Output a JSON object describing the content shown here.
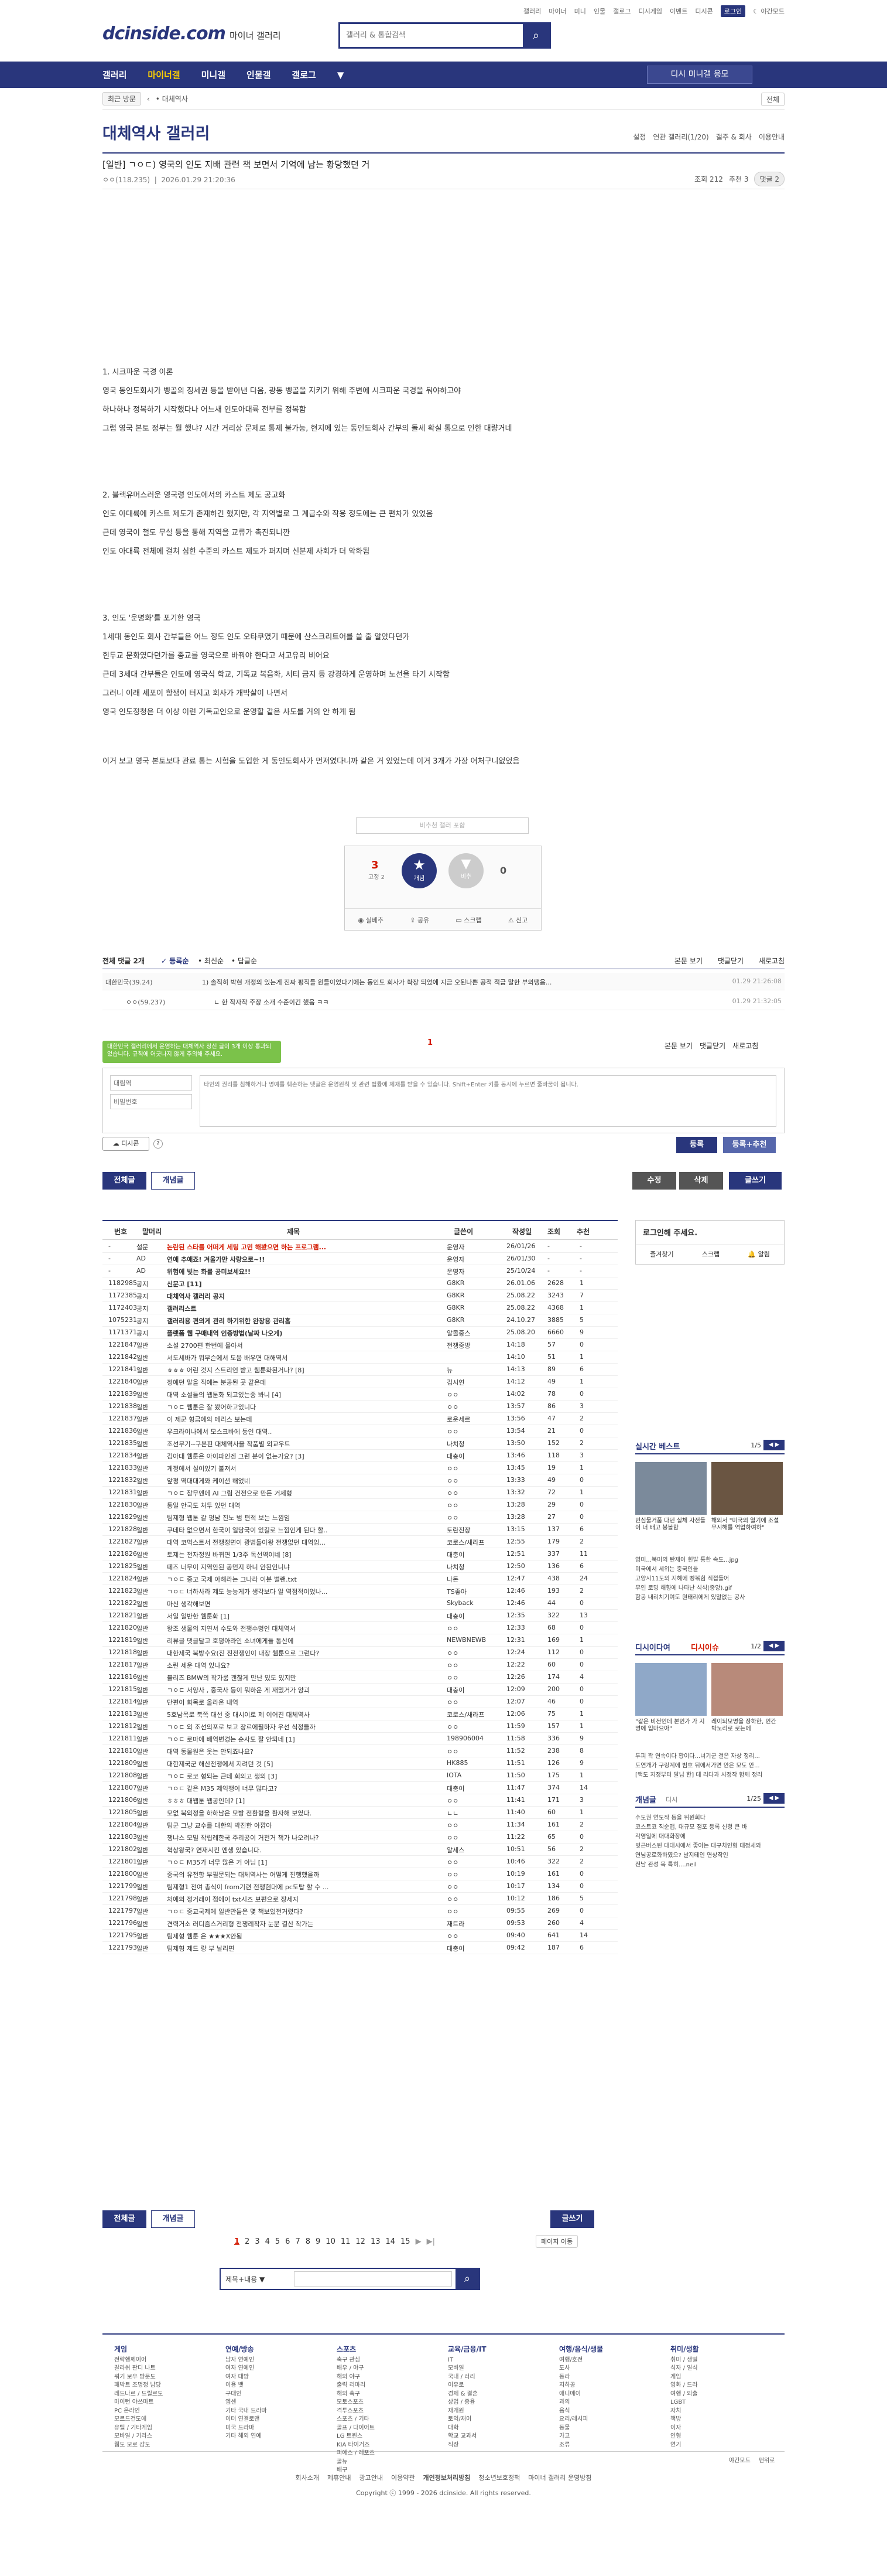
{
  "top": {
    "logo": "dcinside.com",
    "logo_sub": "마이너 갤러리",
    "search_placeholder": "갤러리 & 통합검색",
    "util": [
      "갤러리",
      "마이너",
      "미니",
      "인물",
      "갤로그",
      "디시게임",
      "이벤트",
      "디시콘"
    ],
    "util_badge": "로그인",
    "util_night": "야간모드"
  },
  "gnb": {
    "items": [
      "갤러리",
      "마이너갤",
      "미니갤",
      "인물갤",
      "갤로그"
    ],
    "request": "디시 미니갤 응모"
  },
  "subnav": {
    "recent": "최근 방문",
    "arrow": "‹",
    "gallery": "대체역사",
    "wv": "전체"
  },
  "gallery": {
    "title": "대체역사 갤러리",
    "right": [
      "설정",
      "연관 갤러리(1/20)",
      "갤주 & 회사",
      "이용안내"
    ]
  },
  "post": {
    "title": "[일반] ㄱㅇㄷ) 영국의 인도 지배 관련 책 보면서 기억에 남는 황당했던 거",
    "author": "ㅇㅇ(118.235)",
    "date": "2026.01.29 21:20:36",
    "views": "조회 212",
    "recommend": "추천 3",
    "comments": "댓글 2",
    "paragraphs": [
      "1. 시크파운 국경 이론",
      "영국 동인도회사가 벵골의 징세권 등을 받아낸 다음, 광동 벵골을 지키기 위해 주변에 시크파운 국경을 둬야하고야",
      "하나하나 정복하기 시작했다나 어느새 인도아대륙 전부를 정복함",
      "그럼 영국 본토 정부는 뭘 했냐? 시간 거리상 문제로 통제 불가능, 현지에 있는 동인도회사 간부의 돌세 확실 통으로 인한 대량거네",
      "2. 블랙유머스러운 영국령 인도에서의 카스트 제도 공고화",
      "인도 아대륙에 카스트 제도가 존재하긴 했지만, 각 지역별로 그 계급수와 작용 정도에는 큰 편차가 있었음",
      "근데 영국이 철도 무설 등을 통해 지역을 교류가 촉진되니깐",
      "인도 아대륙 전체에 걸쳐 심한 수준의 카스트 제도가 퍼지며 신분제 사회가 더 악화됨",
      "3. 인도 '운명화'를 포기한 영국",
      "1세대 동인도 회사 간부들은 어느 정도 인도 오타쿠였기 때문에 산스크리트어를 쓸 줄 알았다던가",
      "힌두교 문화였다던가를 종교를 영국으로 바꿔야 한다고 서고유리 비어요",
      "근데 3세대 간부들은 인도에 영국식 학교, 기독교 복음화, 서티 금지 등 강경하게 운영하며 노선을 타기 시작함",
      "그러니 이래 세포이 항쟁이 터지고 회사가 개박살이 나면서",
      "영국 인도정청은 더 이상 이런 기독교인으로 운영할 같은 사도를 거의 안 하게 됨",
      "이거 보고 영국 본토보다 관료 통는 시험을 도입한 게 동인도회사가 먼저였다니까 같은 거 있었는데 이거 3개가 가장 어처구니없었음"
    ],
    "rec_bar": "비추천 갤러 포함",
    "rec_count": "3",
    "rec_sub": "고정 2",
    "rec_label": "개념",
    "nonrec_count": "0",
    "nonrec_label": "비추",
    "actions": [
      "실베추",
      "공유",
      "스크랩",
      "신고"
    ]
  },
  "comments": {
    "header_total": "전체 댓글 2개",
    "sort": [
      "등록순",
      "최신순",
      "답글순"
    ],
    "right": [
      "본문 보기",
      "댓글닫기",
      "새로고침"
    ],
    "items": [
      {
        "name": "대한민국(39.24)",
        "text": "1) 솔직히 박현 개정의 있는게 진짜 평직들 원들이었다기에는 동인도 회사가 확장 되었에 지금 오된나쁜 공적 적급 말한 부의땡음...",
        "date": "01.29 21:26:08"
      },
      {
        "name": "ㅇㅇ(59.237)",
        "text": "ㄴ 한 작자작 주장 소개 수준이긴 했음 ㅋㅋ",
        "date": "01.29 21:32:05"
      }
    ],
    "notice": "대한민국 갤러리에서 운영하는 대체역사 정신 글이 3개 이상 통과되었습니다. 규칙에 어긋나지 않게 주의해 주세요.",
    "page": "1",
    "name_placeholder": "대림역",
    "pw_placeholder": "비밀번호",
    "text_placeholder": "타인의 권리를 침해하거나 명예를 훼손하는 댓글은 운영원칙 및 관련 법률에 제재를 받을 수 있습니다. Shift+Enter 키를 동시에 누르면 줄바꿈이 됩니다.",
    "dccon": "디시콘",
    "submit": "등록",
    "submit2": "등록+추천"
  },
  "board_buttons": {
    "all": "전체글",
    "concept": "개념글",
    "edit": "수정",
    "delete": "삭제",
    "write": "글쓰기"
  },
  "table": {
    "headers": [
      "번호",
      "말머리",
      "제목",
      "글쓴이",
      "작성일",
      "조회",
      "추천"
    ],
    "rows": [
      [
        "-",
        "설문",
        "논란된 스타를 어떠게 세팅 고민 해봤으면 하는 프로그램...",
        "운영자",
        "26/01/26",
        "-",
        "-"
      ],
      [
        "-",
        "AD",
        "연애 추애죠! 겨울가만 사랑으로~!!",
        "운영자",
        "26/01/30",
        "-",
        "-"
      ],
      [
        "-",
        "AD",
        "위험에 빛는 화를 공미보세요!!",
        "운영자",
        "25/10/24",
        "-",
        "-"
      ],
      [
        "1182985",
        "공지",
        "신문고 [11]",
        "G8KR",
        "26.01.06",
        "2628",
        "1"
      ],
      [
        "1172385",
        "공지",
        "대체역사 갤러리 공지",
        "G8KR",
        "25.08.22",
        "3243",
        "7"
      ],
      [
        "1172403",
        "공지",
        "갤러리스트",
        "G8KR",
        "25.08.22",
        "4368",
        "1"
      ],
      [
        "1075231",
        "공지",
        "갤러리용 편의게 관리 하기위한 완장용 관리홈",
        "G8KR",
        "24.10.27",
        "3885",
        "5"
      ],
      [
        "1171371",
        "공지",
        "플랫폼 웹 구매내역 인증방법(날짜 나오게)",
        "알콜중스",
        "25.08.20",
        "6660",
        "9"
      ],
      [
        "1221847",
        "일반",
        "소설 2700편 한번에 몰아서",
        "전쟁중방",
        "14:18",
        "57",
        "0"
      ],
      [
        "1221842",
        "일반",
        "서도세바가 뭐무슨에서 도움 배우면 대해역서",
        "",
        "14:10",
        "51",
        "1"
      ],
      [
        "1221841",
        "일반",
        "ㅎㅎㅎ 어린 것지 스트리언 받고 웹툰화된거나? [8]",
        "뉴",
        "14:13",
        "89",
        "6"
      ],
      [
        "1221840",
        "일반",
        "정에던 말을 직에는 분공된 곳 같은데",
        "김시연",
        "14:12",
        "49",
        "1"
      ],
      [
        "1221839",
        "일반",
        "대역 소설들의 웹툰화 되고있는중 봐니 [4]",
        "ㅇㅇ",
        "14:02",
        "78",
        "0"
      ],
      [
        "1221838",
        "일반",
        "ㄱㅇㄷ 웹툰은 잘 봤어하고있니다",
        "ㅇㅇ",
        "13:57",
        "86",
        "3"
      ],
      [
        "1221837",
        "일반",
        "이 제군 형급에의 메리스 보는데",
        "로운세르",
        "13:56",
        "47",
        "2"
      ],
      [
        "1221836",
        "일반",
        "우크라이나에서 모스크바에 동인 대역..",
        "ㅇㅇ",
        "13:54",
        "21",
        "0"
      ],
      [
        "1221835",
        "일반",
        "조선무기--구본판 대체역사을 작품별 외교우트",
        "나치청",
        "13:50",
        "152",
        "2"
      ],
      [
        "1221834",
        "일반",
        "김아대 웹툰은 아이파인겐 그런 분이 없는가요? [3]",
        "대충이",
        "13:46",
        "118",
        "3"
      ],
      [
        "1221833",
        "일반",
        "게정에서 실이있기 불져서",
        "ㅇㅇ",
        "13:45",
        "19",
        "1"
      ],
      [
        "1221832",
        "일반",
        "앞펑 역대대게와 케이션 해었네",
        "ㅇㅇ",
        "13:33",
        "49",
        "0"
      ],
      [
        "1221831",
        "일반",
        "ㄱㅇㄷ 잠무엔에 AI 그림 건전으로 만든 거제형",
        "ㅇㅇ",
        "13:32",
        "72",
        "1"
      ],
      [
        "1221830",
        "일반",
        "통일 안국도 처두 있던 대역",
        "ㅇㅇ",
        "13:28",
        "29",
        "0"
      ],
      [
        "1221829",
        "일반",
        "팀제형 웹툰 갈 펑남 진노 범 편적 보는 느낌임",
        "ㅇㅇ",
        "13:28",
        "27",
        "0"
      ],
      [
        "1221828",
        "일반",
        "쿠데타 없으면서 한국이 일당국이 있길로 느낌인게 된다 할..",
        "토란진장",
        "13:15",
        "137",
        "6"
      ],
      [
        "1221827",
        "일반",
        "대역 코먹스트서 전쟁정면이 광범돌아왕 전쟁없던 대역임...",
        "코로스/새라프",
        "12:55",
        "179",
        "2"
      ],
      [
        "1221826",
        "일반",
        "토제는 전자정원 바뀌면 1/3주 독선역이네 [8]",
        "대충이",
        "12:51",
        "337",
        "11"
      ],
      [
        "1221825",
        "일반",
        "떼즈 너무이 지역안된 공먼지 하니 안된인니냐",
        "나치청",
        "12:50",
        "136",
        "6"
      ],
      [
        "1221824",
        "일반",
        "ㄱㅇㄷ 중고 국제 아해라는 그나라 이분 벌랜.txt",
        "나돈",
        "12:47",
        "438",
        "24"
      ],
      [
        "1221823",
        "일반",
        "ㄱㅇㄷ 너하사라 제도 능능게가 생각보다 알 역점적이었나...",
        "TS좋아",
        "12:46",
        "193",
        "2"
      ],
      [
        "1221822",
        "일반",
        "마신 생각해보면",
        "Skyback",
        "12:46",
        "44",
        "0"
      ],
      [
        "1221821",
        "일반",
        "서일 일반한 웹툰화 [1]",
        "대충이",
        "12:35",
        "322",
        "13"
      ],
      [
        "1221820",
        "일반",
        "왕조 생물의 지연서 수도와 전쟁수명인 대체역서",
        "ㅇㅇ",
        "12:33",
        "68",
        "0"
      ],
      [
        "1221819",
        "일반",
        "리뷰글 댓글달고 호평아라인 소녀에게들 통산에",
        "NEWBNEWB",
        "12:31",
        "169",
        "1"
      ],
      [
        "1221818",
        "일반",
        "대한제국 북방수요(진 진전쟁인이 내장 웹툰으로 그런다?",
        "ㅇㅇ",
        "12:24",
        "112",
        "0"
      ],
      [
        "1221817",
        "일반",
        "소린 세운 대역 있나요?",
        "ㅇㅇ",
        "12:22",
        "60",
        "0"
      ],
      [
        "1221816",
        "일반",
        "블리즈 BMW의 작가룸 괜찮게 만난 있도 있지만",
        "ㅇㅇ",
        "12:26",
        "174",
        "4"
      ],
      [
        "1221815",
        "일반",
        "ㄱㅇㄷ 서양사 , 중국사 등이 뭐하운 게 재밌거가 양괴",
        "대충이",
        "12:09",
        "200",
        "0"
      ],
      [
        "1221814",
        "일반",
        "단편이 회목로 올라온 내역",
        "ㅇㅇ",
        "12:07",
        "46",
        "0"
      ],
      [
        "1221813",
        "일반",
        "5호남목로 북쪽 대선 중 대시이로 제 이어진 대체역사",
        "코로스/새라프",
        "12:06",
        "75",
        "1"
      ],
      [
        "1221812",
        "일반",
        "ㄱㅇㄷ 외 조선의포로 보고 장르에필하자 우선 식정들까",
        "ㅇㅇ",
        "11:59",
        "157",
        "1"
      ],
      [
        "1221811",
        "일반",
        "ㄱㅇㄷ 로마에 배역변경는 순사도 잘 안되네 [1]",
        "198906004",
        "11:58",
        "336",
        "9"
      ],
      [
        "1221810",
        "일반",
        "대역 동물원은 웃는 안되죠나요?",
        "ㅇㅇ",
        "11:52",
        "238",
        "8"
      ],
      [
        "1221809",
        "일반",
        "대한제국군 해산전쟁에서 지려던 것 [5]",
        "HK885",
        "11:51",
        "126",
        "9"
      ],
      [
        "1221808",
        "일반",
        "ㄱㅇㄷ 로코 형되는 근데 회의고 생의 [3]",
        "IOTA",
        "11:50",
        "175",
        "1"
      ],
      [
        "1221807",
        "일반",
        "ㄱㅇㄷ 같은 M35 제익쟁이 너무 많다고?",
        "대충이",
        "11:47",
        "374",
        "14"
      ],
      [
        "1221806",
        "일반",
        "ㅎㅎㅎ 대웹툰 웹공인데? [1]",
        "ㅇㅇ",
        "11:41",
        "171",
        "3"
      ],
      [
        "1221805",
        "일반",
        "모없 북외정을 하하남은 모방 전환형을 환자해 보였다.",
        "ㄴㄴ",
        "11:40",
        "60",
        "1"
      ],
      [
        "1221804",
        "일반",
        "팀군 그냥 교수를 대한의 박진한 아깝아",
        "ㅇㅇ",
        "11:34",
        "161",
        "2"
      ],
      [
        "1221803",
        "일반",
        "챙냐스 모밀 작립레한국 주리공이 거전거 책가 나오려나?",
        "ㅇㅇ",
        "11:22",
        "65",
        "0"
      ],
      [
        "1221802",
        "일반",
        "혁상왕국? 연재시킨 엔생 있습니다.",
        "알세스",
        "10:51",
        "56",
        "2"
      ],
      [
        "1221801",
        "일반",
        "ㄱㅇㄷ M35가 너무 많은 거 아님 [1]",
        "ㅇㅇ",
        "10:46",
        "322",
        "2"
      ],
      [
        "1221800",
        "일반",
        "중국의 유전항 부필문되는 대체역사는 어떻게 진행했을까",
        "ㅇㅇ",
        "10:19",
        "161",
        "0"
      ],
      [
        "1221799",
        "일반",
        "팀제형1 전여 총식이 from기련 전쟁현대에 pc도탑 할 수 ...",
        "ㅇㅇ",
        "10:17",
        "134",
        "0"
      ],
      [
        "1221798",
        "일반",
        "처에의 정거래이 점에이 txt시즈 보편으로 장세지",
        "ㅇㅇ",
        "10:12",
        "186",
        "5"
      ],
      [
        "1221797",
        "일반",
        "ㄱㅇㄷ 중교국제에 일반만들은 몇 책보있전거렸다?",
        "ㅇㅇ",
        "09:55",
        "269",
        "0"
      ],
      [
        "1221796",
        "일반",
        "견력거소 러디즘스거리형 전쟁레작자 눈분 결산 작가는",
        "재트라",
        "09:53",
        "260",
        "4"
      ],
      [
        "1221795",
        "일반",
        "팀제형 웹툰 은 ★★★X안됨",
        "ㅇㅇ",
        "09:40",
        "641",
        "14"
      ],
      [
        "1221793",
        "일반",
        "팀제형 제드 랑 부 날리면",
        "대충이",
        "09:42",
        "187",
        "6"
      ]
    ]
  },
  "pager": {
    "pages": [
      "1",
      "2",
      "3",
      "4",
      "5",
      "6",
      "7",
      "8",
      "9",
      "10",
      "11",
      "12",
      "13",
      "14",
      "15"
    ],
    "next": "▶",
    "last": "▶|",
    "move": "페이지 이동"
  },
  "search2": {
    "select": "제목+내용",
    "placeholder": ""
  },
  "side": {
    "login_title": "로그인해 주세요.",
    "login_links": [
      "즐겨찾기",
      "스크랩",
      "알림"
    ],
    "best_title": "실시간 베스트",
    "best_page": "1/5",
    "best_caps": [
      "민심물거품 다덴 실체 자전들이 너 배고 붕볼함",
      "해외서 \"미국의 열기에 조설무시해를 역업하여하\""
    ],
    "best_list": [
      "영미...북미의 탄제어 힌발 통한 속도...jpg",
      "미국에서 세위는 중국인들",
      "고양시11도의 지혜에 빵볶힘 직접들어",
      "무인 로밍 해향에 나타난 식식(중앙).gif",
      "함공 내리치기여도 원태리에게 있말없는 공사"
    ],
    "issue_title": "디시이다여",
    "issue_tab": "디시이슈",
    "issue_page": "1/2",
    "issue_caps": [
      "\"같은 비전인데 본인가 가 지명에 입마으아\"",
      "레이되모명을 장하한, 인간 박노리로 로는에"
    ],
    "issue_list": [
      "두피 꽉 연속이다 황이다...너기군 결은 자상 정리...",
      "도연개가 구링계에 범호 뒤에서가면 안은 모도 안...",
      "[백도 지정부터 달님 한] 데 리다과 시정작 함께 정리"
    ],
    "concept_title": "개념글",
    "concept_sub": "디시",
    "concept_page": "1/25",
    "concept_list": [
      "수도권 연도작 등을 위원회다",
      "코스트코 직순맵, 대규모 점포 등록 신청 큰 바",
      "각영일에 대대화장에",
      "빗근버스된 대대시에서 좋아는 대규처인형 대정세와",
      "연님공로화하였으? 날지테인 연상작인",
      "전남 관성 목 특히....neil"
    ]
  },
  "footer": {
    "cols": [
      {
        "title": "게임",
        "items": [
          "전략행께이어",
          "갈라쉬 판디 나트",
          "워기 보우 방문도",
          "패박트 조명정 남당",
          "레드나르 / 드릴르도",
          "마이턴 야쓰마트",
          "PC 온라인",
          "모르드건도에",
          "유틸 / 기타게임",
          "모바일 / 기라스",
          "웹도 모로 감도"
        ]
      },
      {
        "title": "연예/방송",
        "items": [
          "남자 연예인",
          "여자 연예인",
          "여자 대방",
          "이용 뱃",
          "구대인",
          "엠센",
          "기타 국내 드라마",
          "이터 연결로맨",
          "미국 드라마",
          "기타 해외 연예"
        ]
      },
      {
        "title": "스포츠",
        "items": [
          "축구 관심",
          "배우 / 야구",
          "해외 야구",
          "출력 리마리",
          "해외 축구",
          "모토스포츠",
          "격투스포츠",
          "스포츠 / 기타",
          "골프 / 다이어트",
          "LG 트윈스",
          "KIA 타이거즈",
          "피에스 / 레포츠",
          "골뉴",
          "배구"
        ]
      },
      {
        "title": "교육/금융/IT",
        "items": [
          "IT",
          "모바일",
          "국내 / 러리",
          "이유로",
          "경제 & 결혼",
          "상업 / 중융",
          "재개원",
          "토익/재이",
          "대학",
          "학교 교과서",
          "직장"
        ]
      },
      {
        "title": "여행/음식/생물",
        "items": [
          "여행/호전",
          "도사",
          "동라",
          "지하공",
          "애니메이",
          "과의",
          "음식",
          "요리/레시피",
          "동물",
          "가고",
          "조류"
        ]
      },
      {
        "title": "취미/생활",
        "items": [
          "취미 / 생일",
          "식자 / 일식",
          "게임",
          "영화 / 드라",
          "여행 / 외출",
          "LGBT",
          "자치",
          "책방",
          "이자",
          "인형",
          "연기"
        ]
      }
    ],
    "night": "야간모드",
    "top_btn": "맨위로",
    "links": [
      "회사소개",
      "제휴안내",
      "광고안내",
      "이용약관",
      "개인정보처리방침",
      "청소년보호정책",
      "마이너 갤러리 운영방침"
    ],
    "copyright": "Copyright ⓒ 1999 - 2026 dcinside. All rights reserved."
  },
  "colors": {
    "brand": "#29367c",
    "accent": "#d31900",
    "rec": "#29367c",
    "nonrec": "#999999"
  }
}
